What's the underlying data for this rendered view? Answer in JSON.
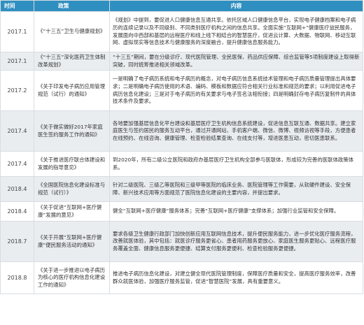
{
  "header": {
    "col_time": "时间",
    "col_policy": "政策",
    "col_content": "内容"
  },
  "rows": [
    {
      "time": "2017.1",
      "policy": "《“十三五”卫生与健康规划》",
      "content": "《规划》中提到，要促进人口健康信息互通共享。依托区域人口健康信息平台，实现电子健康档案和电子病历的连续记录以及不同级别、不同类别医疗机构之间的信息共享。全面实施“互联网+”健康医疗益民服务，发展面向中西部和基层的远程医疗和线上线下相结合的智慧医疗，促进云计算、大数据、物联网、移动互联网、虚拟现实等信息技术与健康服务的深度融合，提升健康信息服务能力。"
    },
    {
      "time": "2017.1",
      "policy": "《“十三五”深化医药卫生体制改革规划》",
      "content": "“十三五”期间，要在分级诊疗、现代医院管理、全民医保、药品供应保障、综合监管等5项制度建设上取得新突破，同时统筹推进相关领域改革。"
    },
    {
      "time": "2017.2",
      "policy": "《关于印发电子病历应用管理规范（试行）的通知》",
      "content": "一是明确了电子病历系统和电子病历的概念，对电子病历信息系统技术管理和电子病历质量管理提出具体要求；二是明确电子病历使用的术语、编码、模板和数据应符合相关行业标准和规范的要求；以利用促进电子病历信息化建设；三是对于电子病历的有关要求与电子签名法相衔接；四是明确封存电子病历复制件的具体技术条件及要求。"
    },
    {
      "time": "2017.4",
      "policy": "《关于做实做好2017年家庭医生签约服务工作的通知》",
      "content": "各地要加强基层信息化平台建设和基层医疗卫生机构信息系统建设，促进信息互联互通、数据共享。建立家庭医生与签约居民的服务互动平台，通过开通网站、手机客户端、微信、微博、视频访视等手段，方便患者在线预约、在线咨询、健康管理、检查检验结果查询、在线支付等，增进医患互动，密切医患联系。"
    },
    {
      "time": "2017.4",
      "policy": "《关于推进医疗联合体建设和发展的指导意见》",
      "content": "到2020年，所有二级公立医院和政府办基层医疗卫生机构全部参与医联体，形成较为完善的医联体政策体系。"
    },
    {
      "time": "2018.4",
      "policy": "《全国医院信息化建设标准与规范（试行）》",
      "content": "针对二级医院、三级乙等医院和三级甲等医院的临床业务、医院管理等工作需要，从软硬件建设、安全保障、新兴技术应用等方面规范了医院信息化建设的主要内容，并提出要求。"
    },
    {
      "time": "2018.4",
      "policy": "《关于促进“互联网+医疗健康”发展的意见》",
      "content": "健全“互联网+医疗健康”服务体系；完善“互联网+医疗健康”支撑体系；加强行业监管和安全保障。"
    },
    {
      "time": "2018.7",
      "policy": "《关于开展“互联网+医疗健康”便民服务活动的通知》",
      "content": "要求各级卫生健康行政部门加快创新应用互联网信息技术，提升便民服务能力，进一步优化医疗服务流程，改善就医体验，其中包括：就医诊疗服务更省心、患者用药服务更放心、家庭医生服务更贴心、远程医疗服务覆盖全面、健康信息服务更便捷、结算支付服务更便利、检查检验服务更便捷。"
    },
    {
      "time": "2018.8",
      "policy": "《关于进一步推进以电子病历为核心的医疗机构信息化建设工作的通知》",
      "content": "推进电子病历信息化建设，对建立健全现代医院管理制度，保障医疗质量和安全，提高医疗服务效率，改善群众就医体验，加强医疗服务监管，促进“智慧医院”发展，具有重要意义。"
    }
  ]
}
